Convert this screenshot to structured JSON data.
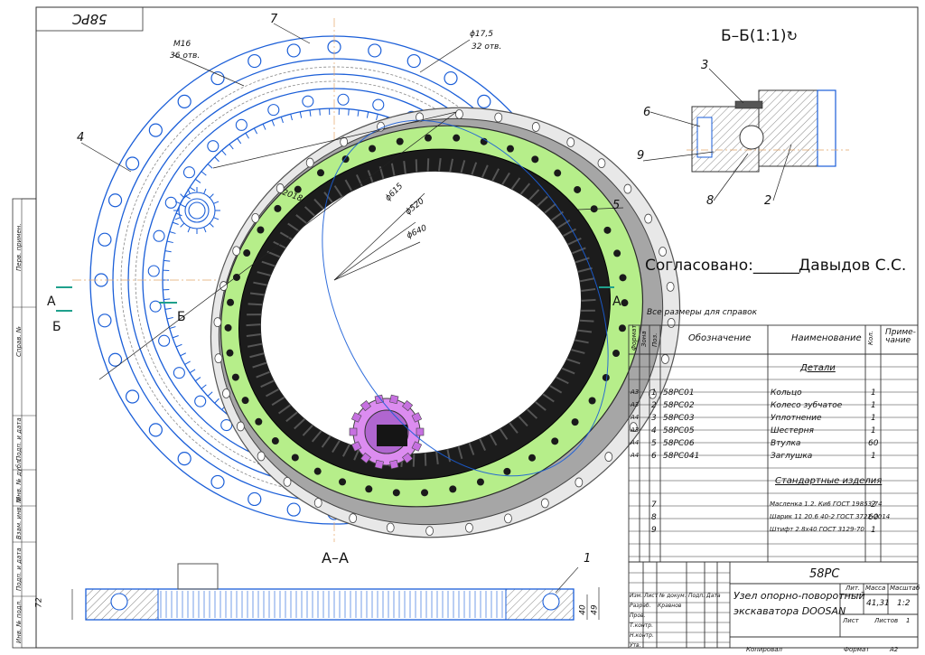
{
  "sheet": {
    "top_code": "58PC",
    "section_title": "Б–Б(1:1)",
    "section_aa": "А–А",
    "approval": "Согласовано:______",
    "approver": "Давыдов С.С.",
    "note": "Все размеры для справок",
    "format_label": "Формат",
    "format_value": "А2",
    "copied_label": "Копировал"
  },
  "dimensions": {
    "m16": "М16",
    "m16_holes": "36 отв.",
    "d175": "ϕ17,5",
    "d175_holes": "32 отв.",
    "d2018": "2018",
    "d615": "ϕ615",
    "d520": "ϕ520",
    "d640": "ϕ640",
    "h72": "72",
    "h40": "40",
    "h49": "49"
  },
  "callouts": [
    "7",
    "4",
    "5",
    "1",
    "3",
    "6",
    "9",
    "8",
    "2"
  ],
  "section_marks": [
    "А",
    "Б",
    "А",
    "Б",
    "А"
  ],
  "spec": {
    "headers": {
      "format": "Формат",
      "zone": "Зона",
      "pos": "Поз.",
      "designation": "Обозначение",
      "name": "Наименование",
      "qty": "Кол.",
      "note": "Приме-\nчание"
    },
    "section_parts": "Детали",
    "parts": [
      {
        "fmt": "А3",
        "pos": "1",
        "code": "58PC01",
        "name": "Кольцо",
        "qty": "1"
      },
      {
        "fmt": "А3",
        "pos": "2",
        "code": "58PC02",
        "name": "Колесо зубчатое",
        "qty": "1"
      },
      {
        "fmt": "А4",
        "pos": "3",
        "code": "58PC03",
        "name": "Уплотнение",
        "qty": "1"
      },
      {
        "fmt": "А3",
        "pos": "4",
        "code": "58PC05",
        "name": "Шестерня",
        "qty": "1"
      },
      {
        "fmt": "А4",
        "pos": "5",
        "code": "58PC06",
        "name": "Втулка",
        "qty": "60"
      },
      {
        "fmt": "А4",
        "pos": "6",
        "code": "58PC041",
        "name": "Заглушка",
        "qty": "1"
      }
    ],
    "section_std": "Стандартные изделия",
    "std": [
      {
        "pos": "7",
        "name": "Масленка 1.2. Ки6 ГОСТ 19853-74",
        "qty": "2"
      },
      {
        "pos": "8",
        "name": "Шарик 11 20.6 40-2 ГОСТ 3722-2014",
        "qty": "60"
      },
      {
        "pos": "9",
        "name": "Штифт 2.8х40 ГОСТ 3129-70",
        "qty": "1"
      }
    ]
  },
  "title_block": {
    "code": "58PC",
    "title_line1": "Узел опорно-поворотный",
    "title_line2": "экскаватора DOOSAN",
    "lit_label": "Лит.",
    "mass_label": "Масса",
    "scale_label": "Масштаб",
    "mass": "41,31",
    "scale": "1:2",
    "sheet_label": "Лист",
    "sheets_label": "Листов",
    "sheets": "1",
    "rows": [
      "Изм.",
      "Лист",
      "№ докум.",
      "Подп.",
      "Дата"
    ],
    "roles": [
      "Разраб.",
      "Пров.",
      "Т.контр.",
      "Н.контр.",
      "Утв."
    ],
    "author": "Кравнов"
  },
  "side_stamps": [
    "Перв. примен.",
    "Справ. №",
    "Подп. и дата",
    "Инв. № дубл.",
    "Взам. инв. №",
    "Подп. и дата",
    "Инв. № подл."
  ],
  "colors": {
    "blue": "#1a5ed8",
    "green": "#b6ee8a",
    "gray": "#a6a6a6",
    "dark": "#151515",
    "pink": "#dc8cf0"
  }
}
